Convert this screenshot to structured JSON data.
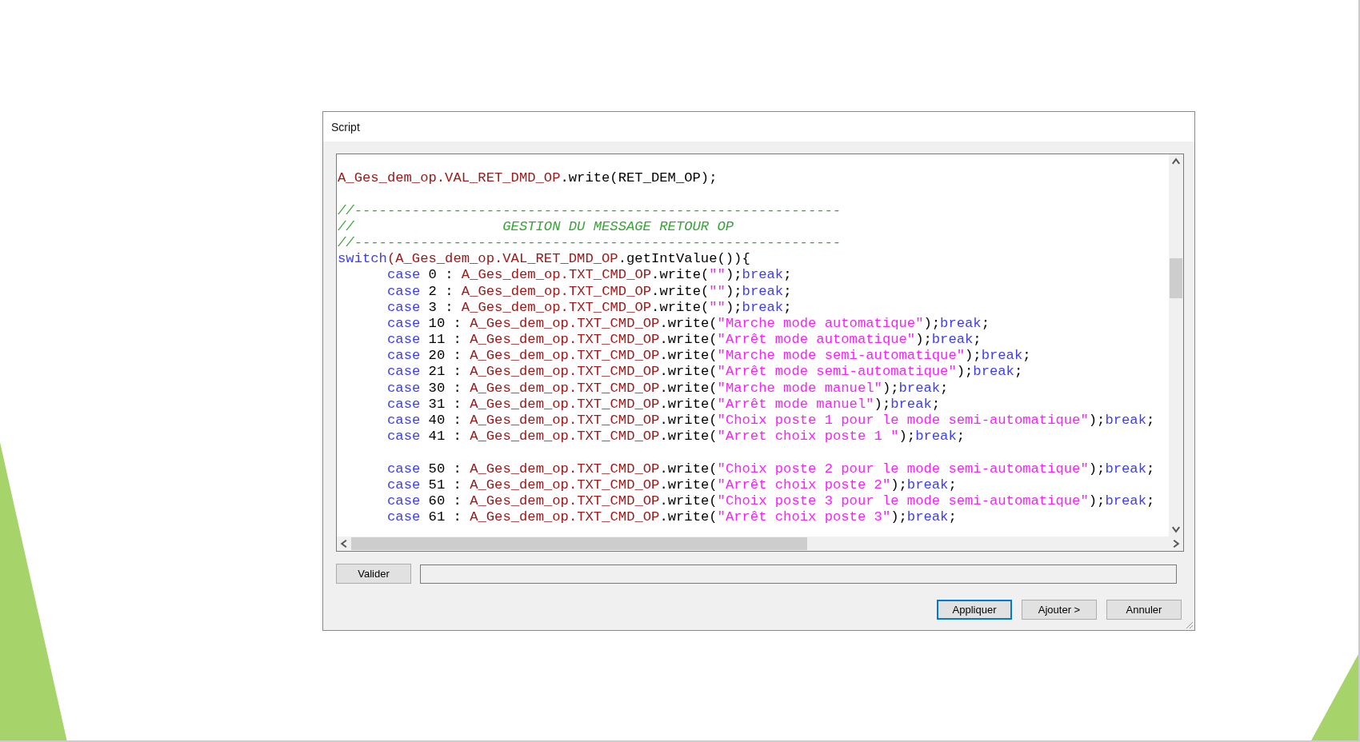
{
  "window": {
    "title": "Script"
  },
  "code_lines": [
    {
      "kind": "blank"
    },
    {
      "kind": "code",
      "tokens": [
        {
          "kind": "ident",
          "text": "A_Ges_dem_op.VAL_RET_DMD_OP"
        },
        {
          "kind": "plain",
          "text": ".write(RET_DEM_OP);"
        }
      ]
    },
    {
      "kind": "blank"
    },
    {
      "kind": "code",
      "tokens": [
        {
          "kind": "comment",
          "text": "//-----------------------------------------------------------"
        }
      ]
    },
    {
      "kind": "code",
      "tokens": [
        {
          "kind": "comment",
          "text": "//                  GESTION DU MESSAGE RETOUR OP"
        }
      ]
    },
    {
      "kind": "code",
      "tokens": [
        {
          "kind": "comment",
          "text": "//-----------------------------------------------------------"
        }
      ]
    },
    {
      "kind": "code",
      "tokens": [
        {
          "kind": "keyword",
          "text": "switch"
        },
        {
          "kind": "ident",
          "text": "(A_Ges_dem_op.VAL_RET_DMD_OP"
        },
        {
          "kind": "plain",
          "text": ".getIntValue()){"
        }
      ],
      "children": [
        {
          "kind": "code",
          "tokens": [
            {
              "kind": "keyword",
              "text": "case"
            },
            {
              "kind": "plain",
              "text": " 0 : "
            },
            {
              "kind": "ident",
              "text": "A_Ges_dem_op.TXT_CMD_OP"
            },
            {
              "kind": "plain",
              "text": ".write("
            },
            {
              "kind": "string",
              "text": "\"\""
            },
            {
              "kind": "plain",
              "text": ");"
            },
            {
              "kind": "keyword",
              "text": "break"
            },
            {
              "kind": "plain",
              "text": ";"
            }
          ]
        },
        {
          "kind": "code",
          "tokens": [
            {
              "kind": "keyword",
              "text": "case"
            },
            {
              "kind": "plain",
              "text": " 2 : "
            },
            {
              "kind": "ident",
              "text": "A_Ges_dem_op.TXT_CMD_OP"
            },
            {
              "kind": "plain",
              "text": ".write("
            },
            {
              "kind": "string",
              "text": "\"\""
            },
            {
              "kind": "plain",
              "text": ");"
            },
            {
              "kind": "keyword",
              "text": "break"
            },
            {
              "kind": "plain",
              "text": ";"
            }
          ]
        },
        {
          "kind": "code",
          "tokens": [
            {
              "kind": "keyword",
              "text": "case"
            },
            {
              "kind": "plain",
              "text": " 3 : "
            },
            {
              "kind": "ident",
              "text": "A_Ges_dem_op.TXT_CMD_OP"
            },
            {
              "kind": "plain",
              "text": ".write("
            },
            {
              "kind": "string",
              "text": "\"\""
            },
            {
              "kind": "plain",
              "text": ");"
            },
            {
              "kind": "keyword",
              "text": "break"
            },
            {
              "kind": "plain",
              "text": ";"
            }
          ]
        },
        {
          "kind": "code",
          "tokens": [
            {
              "kind": "keyword",
              "text": "case"
            },
            {
              "kind": "plain",
              "text": " 10 : "
            },
            {
              "kind": "ident",
              "text": "A_Ges_dem_op.TXT_CMD_OP"
            },
            {
              "kind": "plain",
              "text": ".write("
            },
            {
              "kind": "string",
              "text": "\"Marche mode automatique\""
            },
            {
              "kind": "plain",
              "text": ");"
            },
            {
              "kind": "keyword",
              "text": "break"
            },
            {
              "kind": "plain",
              "text": ";"
            }
          ]
        },
        {
          "kind": "code",
          "tokens": [
            {
              "kind": "keyword",
              "text": "case"
            },
            {
              "kind": "plain",
              "text": " 11 : "
            },
            {
              "kind": "ident",
              "text": "A_Ges_dem_op.TXT_CMD_OP"
            },
            {
              "kind": "plain",
              "text": ".write("
            },
            {
              "kind": "string",
              "text": "\"Arrêt mode automatique\""
            },
            {
              "kind": "plain",
              "text": ");"
            },
            {
              "kind": "keyword",
              "text": "break"
            },
            {
              "kind": "plain",
              "text": ";"
            }
          ]
        },
        {
          "kind": "code",
          "tokens": [
            {
              "kind": "keyword",
              "text": "case"
            },
            {
              "kind": "plain",
              "text": " 20 : "
            },
            {
              "kind": "ident",
              "text": "A_Ges_dem_op.TXT_CMD_OP"
            },
            {
              "kind": "plain",
              "text": ".write("
            },
            {
              "kind": "string",
              "text": "\"Marche mode semi-automatique\""
            },
            {
              "kind": "plain",
              "text": ");"
            },
            {
              "kind": "keyword",
              "text": "break"
            },
            {
              "kind": "plain",
              "text": ";"
            }
          ]
        },
        {
          "kind": "code",
          "tokens": [
            {
              "kind": "keyword",
              "text": "case"
            },
            {
              "kind": "plain",
              "text": " 21 : "
            },
            {
              "kind": "ident",
              "text": "A_Ges_dem_op.TXT_CMD_OP"
            },
            {
              "kind": "plain",
              "text": ".write("
            },
            {
              "kind": "string",
              "text": "\"Arrêt mode semi-automatique\""
            },
            {
              "kind": "plain",
              "text": ");"
            },
            {
              "kind": "keyword",
              "text": "break"
            },
            {
              "kind": "plain",
              "text": ";"
            }
          ]
        },
        {
          "kind": "code",
          "tokens": [
            {
              "kind": "keyword",
              "text": "case"
            },
            {
              "kind": "plain",
              "text": " 30 : "
            },
            {
              "kind": "ident",
              "text": "A_Ges_dem_op.TXT_CMD_OP"
            },
            {
              "kind": "plain",
              "text": ".write("
            },
            {
              "kind": "string",
              "text": "\"Marche mode manuel\""
            },
            {
              "kind": "plain",
              "text": ");"
            },
            {
              "kind": "keyword",
              "text": "break"
            },
            {
              "kind": "plain",
              "text": ";"
            }
          ]
        },
        {
          "kind": "code",
          "tokens": [
            {
              "kind": "keyword",
              "text": "case"
            },
            {
              "kind": "plain",
              "text": " 31 : "
            },
            {
              "kind": "ident",
              "text": "A_Ges_dem_op.TXT_CMD_OP"
            },
            {
              "kind": "plain",
              "text": ".write("
            },
            {
              "kind": "string",
              "text": "\"Arrêt mode manuel\""
            },
            {
              "kind": "plain",
              "text": ");"
            },
            {
              "kind": "keyword",
              "text": "break"
            },
            {
              "kind": "plain",
              "text": ";"
            }
          ]
        },
        {
          "kind": "code",
          "tokens": [
            {
              "kind": "keyword",
              "text": "case"
            },
            {
              "kind": "plain",
              "text": " 40 : "
            },
            {
              "kind": "ident",
              "text": "A_Ges_dem_op.TXT_CMD_OP"
            },
            {
              "kind": "plain",
              "text": ".write("
            },
            {
              "kind": "string",
              "text": "\"Choix poste 1 pour le mode semi-automatique\""
            },
            {
              "kind": "plain",
              "text": ");"
            },
            {
              "kind": "keyword",
              "text": "break"
            },
            {
              "kind": "plain",
              "text": ";"
            }
          ]
        },
        {
          "kind": "code",
          "tokens": [
            {
              "kind": "keyword",
              "text": "case"
            },
            {
              "kind": "plain",
              "text": " 41 : "
            },
            {
              "kind": "ident",
              "text": "A_Ges_dem_op.TXT_CMD_OP"
            },
            {
              "kind": "plain",
              "text": ".write("
            },
            {
              "kind": "string",
              "text": "\"Arret choix poste 1 \""
            },
            {
              "kind": "plain",
              "text": ");"
            },
            {
              "kind": "keyword",
              "text": "break"
            },
            {
              "kind": "plain",
              "text": ";"
            }
          ]
        },
        {
          "kind": "blank"
        },
        {
          "kind": "code",
          "tokens": [
            {
              "kind": "keyword",
              "text": "case"
            },
            {
              "kind": "plain",
              "text": " 50 : "
            },
            {
              "kind": "ident",
              "text": "A_Ges_dem_op.TXT_CMD_OP"
            },
            {
              "kind": "plain",
              "text": ".write("
            },
            {
              "kind": "string",
              "text": "\"Choix poste 2 pour le mode semi-automatique\""
            },
            {
              "kind": "plain",
              "text": ");"
            },
            {
              "kind": "keyword",
              "text": "break"
            },
            {
              "kind": "plain",
              "text": ";"
            }
          ]
        },
        {
          "kind": "code",
          "tokens": [
            {
              "kind": "keyword",
              "text": "case"
            },
            {
              "kind": "plain",
              "text": " 51 : "
            },
            {
              "kind": "ident",
              "text": "A_Ges_dem_op.TXT_CMD_OP"
            },
            {
              "kind": "plain",
              "text": ".write("
            },
            {
              "kind": "string",
              "text": "\"Arrêt choix poste 2\""
            },
            {
              "kind": "plain",
              "text": ");"
            },
            {
              "kind": "keyword",
              "text": "break"
            },
            {
              "kind": "plain",
              "text": ";"
            }
          ]
        },
        {
          "kind": "code",
          "tokens": [
            {
              "kind": "keyword",
              "text": "case"
            },
            {
              "kind": "plain",
              "text": " 60 : "
            },
            {
              "kind": "ident",
              "text": "A_Ges_dem_op.TXT_CMD_OP"
            },
            {
              "kind": "plain",
              "text": ".write("
            },
            {
              "kind": "string",
              "text": "\"Choix poste 3 pour le mode semi-automatique\""
            },
            {
              "kind": "plain",
              "text": ");"
            },
            {
              "kind": "keyword",
              "text": "break"
            },
            {
              "kind": "plain",
              "text": ";"
            }
          ]
        },
        {
          "kind": "code",
          "tokens": [
            {
              "kind": "keyword",
              "text": "case"
            },
            {
              "kind": "plain",
              "text": " 61 : "
            },
            {
              "kind": "ident",
              "text": "A_Ges_dem_op.TXT_CMD_OP"
            },
            {
              "kind": "plain",
              "text": ".write("
            },
            {
              "kind": "string",
              "text": "\"Arrêt choix poste 3\""
            },
            {
              "kind": "plain",
              "text": ");"
            },
            {
              "kind": "keyword",
              "text": "break"
            },
            {
              "kind": "plain",
              "text": ";"
            }
          ]
        }
      ]
    }
  ],
  "validate_button": {
    "label": "Valider"
  },
  "buttons": [
    {
      "label": "Appliquer",
      "focused": true
    },
    {
      "label": "Ajouter >",
      "focused": false
    },
    {
      "label": "Annuler",
      "focused": false
    }
  ]
}
